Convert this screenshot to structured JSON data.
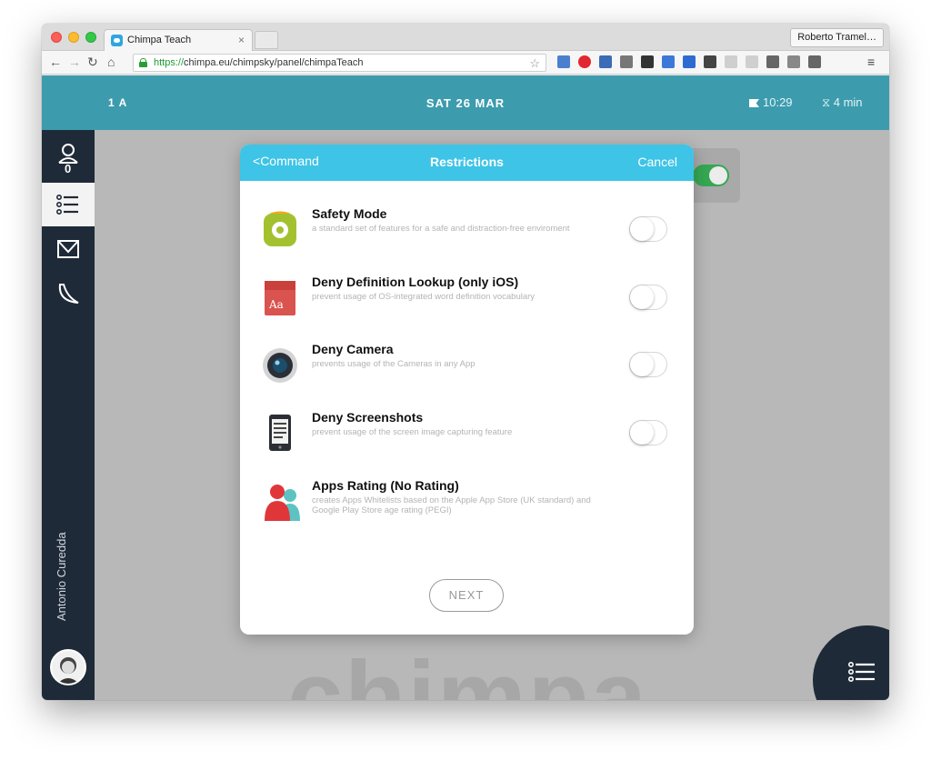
{
  "browser": {
    "tab_title": "Chimpa Teach",
    "tab_close": "×",
    "user_button": "Roberto Tramel…",
    "url_proto": "https://",
    "url_rest": "chimpa.eu/chimpsky/panel/chimpaTeach"
  },
  "topbar": {
    "class_name": "1 A",
    "date": "SAT 26 MAR",
    "time": "10:29",
    "duration": "4 min",
    "color": "#3c9cad"
  },
  "sidebar": {
    "user_name": "Antonio Curedda",
    "badge_count": "0",
    "items": [
      {
        "icon": "students-icon"
      },
      {
        "icon": "list-icon",
        "active": true
      },
      {
        "icon": "classroom-icon"
      },
      {
        "icon": "banana-icon"
      }
    ]
  },
  "background": {
    "watermark": "chimpa"
  },
  "modal": {
    "back_label": "Command",
    "title": "Restrictions",
    "cancel_label": "Cancel",
    "header_color": "#3ec4e6",
    "next_label": "NEXT",
    "items": [
      {
        "title": "Safety Mode",
        "desc": "a standard set of features for a safe and distraction-free enviroment",
        "icon": "safety-gear-icon",
        "toggle": false
      },
      {
        "title": "Deny Definition Lookup (only iOS)",
        "desc": "prevent usage of OS-integrated word definition vocabulary",
        "icon": "dictionary-icon",
        "toggle": false
      },
      {
        "title": "Deny Camera",
        "desc": "prevents usage of the Cameras in any App",
        "icon": "camera-icon",
        "toggle": false
      },
      {
        "title": "Deny Screenshots",
        "desc": "prevent usage of the screen image capturing feature",
        "icon": "screenshot-icon",
        "toggle": false
      },
      {
        "title": "Apps Rating (No Rating)",
        "desc": "creates Apps Whitelists based on the Apple App Store (UK standard) and Google Play Store age rating (PEGI)",
        "icon": "people-rating-icon"
      }
    ]
  }
}
